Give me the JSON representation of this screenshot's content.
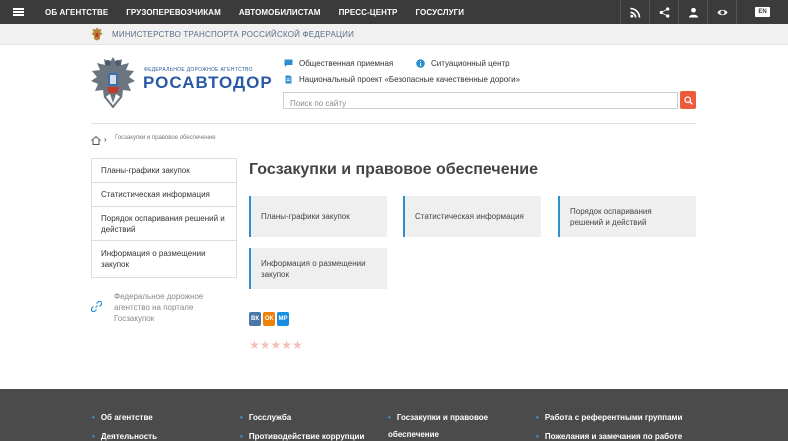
{
  "topnav": {
    "links": [
      "ОБ АГЕНТСТВЕ",
      "ГРУЗОПЕРЕВОЗЧИКАМ",
      "АВТОМОБИЛИСТАМ",
      "ПРЕСС-ЦЕНТР",
      "ГОСУСЛУГИ"
    ],
    "icons": [
      "rss-icon",
      "share-icon",
      "user-icon",
      "eye-icon"
    ],
    "lang": "EN"
  },
  "ministry": {
    "text": "МИНИСТЕРСТВО ТРАНСПОРТА РОССИЙСКОЙ ФЕДЕРАЦИИ"
  },
  "header": {
    "agency_small": "ФЕДЕРАЛЬНОЕ ДОРОЖНОЕ АГЕНТСТВО",
    "agency_big": "РОСАВТОДОР",
    "link_reception": "Общественная приемная",
    "link_situation": "Ситуационный центр",
    "link_project": "Национальный проект «Безопасные качественные дороги»",
    "search_placeholder": "Поиск по сайту"
  },
  "breadcrumb": {
    "current": "Госзакупки и правовое обеспечение"
  },
  "sidebar": {
    "items": [
      "Планы-графики закупок",
      "Статистическая информация",
      "Порядок оспаривания решений и действий",
      "Информация о размещении закупок"
    ],
    "portal_text": "Федеральное дорожное агентство на портале Госзакупок"
  },
  "main": {
    "title": "Госзакупки и правовое обеспечение",
    "cards": [
      "Планы-графики закупок",
      "Статистическая информация",
      "Порядок оспаривания решений и действий",
      "Информация о размещении закупок"
    ],
    "share": [
      "ВК",
      "ОК",
      "МР"
    ],
    "share_colors": [
      "#4a76a8",
      "#ee8208",
      "#168de2"
    ],
    "rating_stars": "★★★★★"
  },
  "footer": {
    "items": [
      "Об агентстве",
      "Деятельность",
      "Госслужба",
      "Противодействие коррупции",
      "Госзакупки и правовое обеспечение",
      "Работа с референтными группами",
      "Пожелания и замечания по работе"
    ]
  },
  "colors": {
    "accent": "#2d8fd0",
    "search_button": "#ee5a3c",
    "topnav": "#3b3b3b",
    "footer": "#4b4b4b"
  }
}
